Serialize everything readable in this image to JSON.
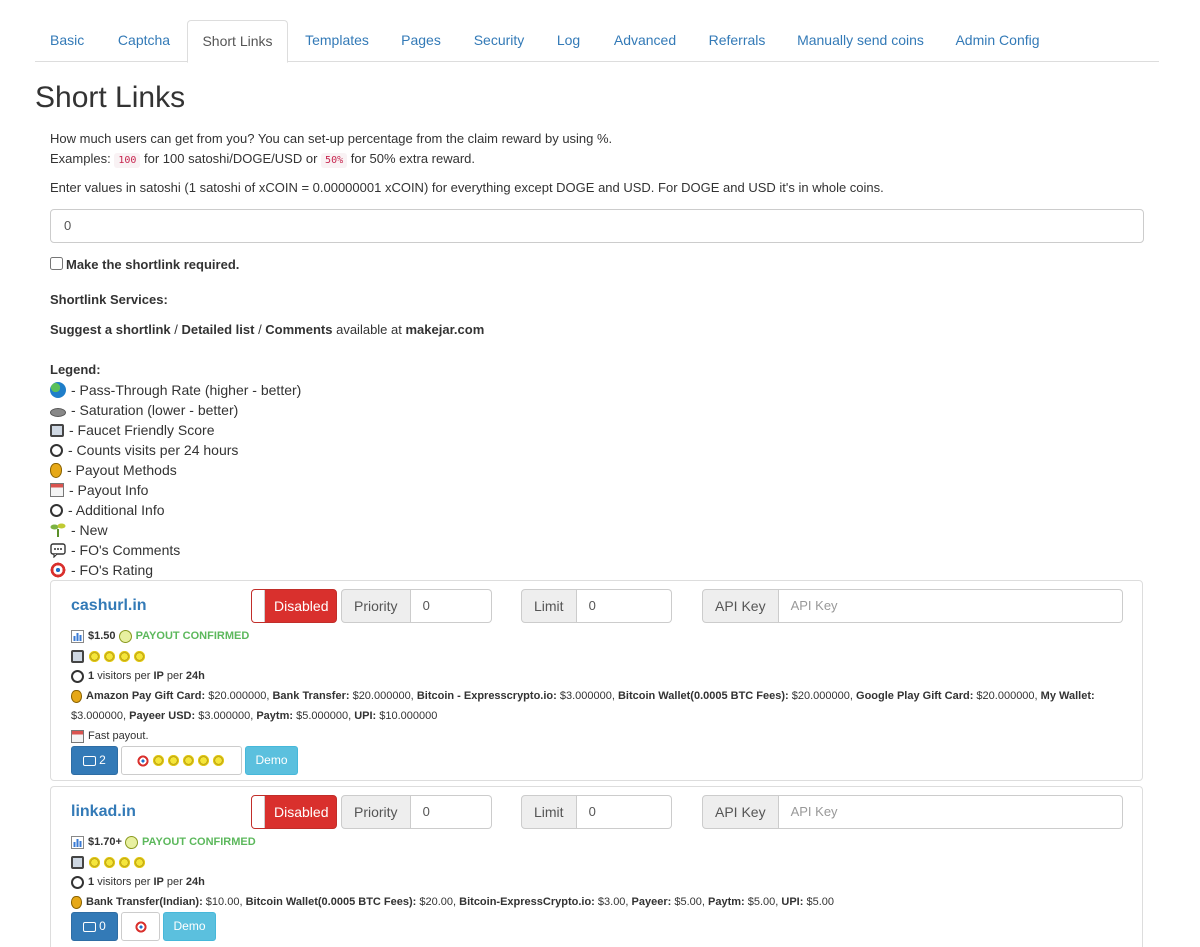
{
  "tabs": [
    "Basic",
    "Captcha",
    "Short Links",
    "Templates",
    "Pages",
    "Security",
    "Log",
    "Advanced",
    "Referrals",
    "Manually send coins",
    "Admin Config"
  ],
  "active_tab": "Short Links",
  "page_title": "Short Links",
  "intro": {
    "line1": "How much users can get from you? You can set-up percentage from the claim reward by using %.",
    "examples_prefix": "Examples:",
    "code1": "100",
    "mid1": "for 100 satoshi/DOGE/USD or",
    "code2": "50%",
    "mid2": "for 50% extra reward.",
    "line3": "Enter values in satoshi (1 satoshi of xCOIN = 0.00000001 xCOIN) for everything except DOGE and USD. For DOGE and USD it's in whole coins."
  },
  "reward_input_value": "0",
  "required_checkbox_label": "Make the shortlink required.",
  "services_heading": "Shortlink Services:",
  "links_line": {
    "suggest": "Suggest a shortlink",
    "sep1": " / ",
    "detailed": "Detailed list",
    "sep2": " / ",
    "comments": "Comments",
    "avail": " available at ",
    "site": "makejar.com"
  },
  "legend": {
    "title": "Legend:",
    "items": [
      {
        "icon": "globe-icon",
        "text": "- Pass-Through Rate (higher - better)"
      },
      {
        "icon": "saturation-icon",
        "text": "- Saturation (lower - better)"
      },
      {
        "icon": "monitor-icon",
        "text": "- Faucet Friendly Score"
      },
      {
        "icon": "stopwatch-icon",
        "text": "- Counts visits per 24 hours"
      },
      {
        "icon": "money-bag-icon",
        "text": "- Payout Methods"
      },
      {
        "icon": "calendar-icon",
        "text": "- Payout Info"
      },
      {
        "icon": "stopwatch-icon",
        "text": "- Additional Info"
      },
      {
        "icon": "seedling-icon",
        "text": "- New"
      },
      {
        "icon": "speech-bubble-icon",
        "text": "- FO's Comments"
      },
      {
        "icon": "target-icon",
        "text": "- FO's Rating"
      }
    ]
  },
  "services": [
    {
      "name": "cashurl.in",
      "toggle_label": "Disabled",
      "priority_label": "Priority",
      "priority_value": "0",
      "limit_label": "Limit",
      "limit_value": "0",
      "apikey_label": "API Key",
      "apikey_placeholder": "API Key",
      "cpm": "$1.50",
      "payout_status": "PAYOUT CONFIRMED",
      "faucet_score": 4,
      "visits_count": "1",
      "visits_text": "visitors per",
      "visits_ip": "IP",
      "visits_per": "per",
      "visits_period": "24h",
      "payout_methods": [
        {
          "name": "Amazon Pay Gift Card:",
          "amount": "$20.000000"
        },
        {
          "name": "Bank Transfer:",
          "amount": "$20.000000"
        },
        {
          "name": "Bitcoin - Expresscrypto.io:",
          "amount": "$3.000000"
        },
        {
          "name": "Bitcoin Wallet(0.0005 BTC Fees):",
          "amount": "$20.000000"
        },
        {
          "name": "Google Play Gift Card:",
          "amount": "$20.000000"
        },
        {
          "name": "My Wallet:",
          "amount": "$3.000000"
        },
        {
          "name": "Payeer USD:",
          "amount": "$3.000000"
        },
        {
          "name": "Paytm:",
          "amount": "$5.000000"
        },
        {
          "name": "UPI:",
          "amount": "$10.000000"
        }
      ],
      "payout_info": "Fast payout.",
      "comments_count": "2",
      "rating_stars": 5,
      "demo_label": "Demo"
    },
    {
      "name": "linkad.in",
      "toggle_label": "Disabled",
      "priority_label": "Priority",
      "priority_value": "0",
      "limit_label": "Limit",
      "limit_value": "0",
      "apikey_label": "API Key",
      "apikey_placeholder": "API Key",
      "cpm": "$1.70+",
      "payout_status": "PAYOUT CONFIRMED",
      "faucet_score": 4,
      "visits_count": "1",
      "visits_text": "visitors per",
      "visits_ip": "IP",
      "visits_per": "per",
      "visits_period": "24h",
      "payout_methods": [
        {
          "name": "Bank Transfer(Indian):",
          "amount": "$10.00"
        },
        {
          "name": "Bitcoin Wallet(0.0005 BTC Fees):",
          "amount": "$20.00"
        },
        {
          "name": "Bitcoin-ExpressCrypto.io:",
          "amount": "$3.00"
        },
        {
          "name": "Payeer:",
          "amount": "$5.00"
        },
        {
          "name": "Paytm:",
          "amount": "$5.00"
        },
        {
          "name": "UPI:",
          "amount": "$5.00"
        }
      ],
      "comments_count": "0",
      "rating_stars": 0,
      "demo_label": "Demo"
    }
  ]
}
